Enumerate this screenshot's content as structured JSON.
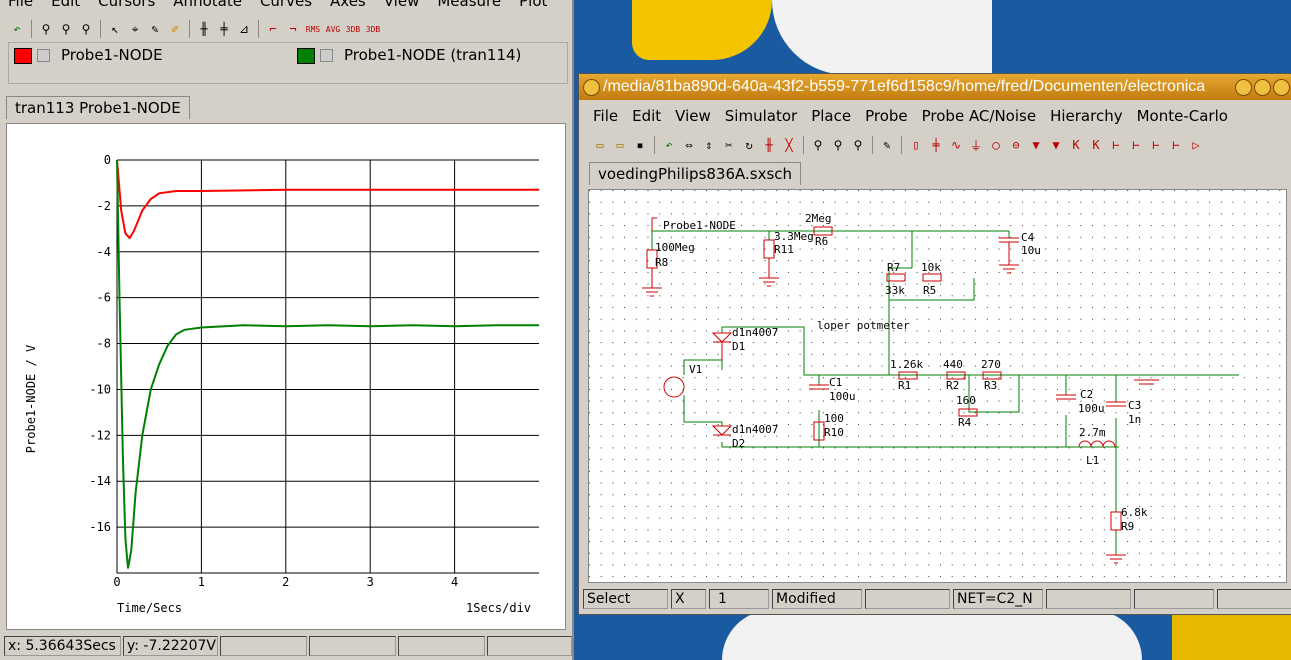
{
  "left_window": {
    "menu": [
      "File",
      "Edit",
      "Cursors",
      "Annotate",
      "Curves",
      "Axes",
      "View",
      "Measure",
      "Plot"
    ],
    "legend": [
      {
        "label": "Probe1-NODE",
        "color": "#ff0000"
      },
      {
        "label": "Probe1-NODE (tran114)",
        "color": "#008000"
      }
    ],
    "tab": "tran113 Probe1-NODE",
    "status": {
      "x": "x: 5.36643Secs",
      "y": "y: -7.22207V"
    }
  },
  "right_window": {
    "title": "/media/81ba890d-640a-43f2-b559-771ef6d158c9/home/fred/Documenten/electronica",
    "menu": [
      "File",
      "Edit",
      "View",
      "Simulator",
      "Place",
      "Probe",
      "Probe AC/Noise",
      "Hierarchy",
      "Monte-Carlo"
    ],
    "tab": "voedingPhilips836A.sxsch",
    "status": {
      "mode": "Select",
      "x_label": "X",
      "x_value": "1",
      "modified": "Modified",
      "net": "NET=C2_N"
    }
  },
  "schematic": {
    "labels": {
      "probe": "Probe1-NODE",
      "r8_val": "100Meg",
      "r8": "R8",
      "r11_val": "3.3Meg",
      "r11": "R11",
      "r6_val": "2Meg",
      "r6": "R6",
      "c4": "C4",
      "c4_val": "10u",
      "r7": "R7",
      "r7_val": "33k",
      "r5_val": "10k",
      "r5": "R5",
      "note": "loper potmeter",
      "d1_val": "d1n4007",
      "d1": "D1",
      "v1": "V1",
      "d2_val": "d1n4007",
      "d2": "D2",
      "c1": "C1",
      "c1_val": "100u",
      "r10_val": "100",
      "r10": "R10",
      "r1_val": "1.26k",
      "r1": "R1",
      "r2_val": "440",
      "r2": "R2",
      "r3_val": "270",
      "r3": "R3",
      "r4_val": "160",
      "r4": "R4",
      "c2": "C2",
      "c2_val": "100u",
      "c3": "C3",
      "c3_val": "1n",
      "l1_val": "2.7m",
      "l1": "L1",
      "r9_val": "6.8k",
      "r9": "R9"
    }
  },
  "chart_data": {
    "type": "line",
    "xlabel": "Time/Secs",
    "ylabel": "Probe1-NODE / V",
    "scale_note": "1Secs/div",
    "xlim": [
      0,
      5
    ],
    "ylim": [
      -18,
      0
    ],
    "x_ticks": [
      "0",
      "1",
      "2",
      "3",
      "4"
    ],
    "y_ticks": [
      "0",
      "-2",
      "-4",
      "-6",
      "-8",
      "-10",
      "-12",
      "-14",
      "-16"
    ],
    "grid": true,
    "series": [
      {
        "name": "Probe1-NODE",
        "color": "#ff0000",
        "x": [
          0,
          0.05,
          0.1,
          0.15,
          0.2,
          0.3,
          0.4,
          0.5,
          0.7,
          1,
          2,
          3,
          4,
          5
        ],
        "y": [
          0,
          -2.2,
          -3.2,
          -3.4,
          -3.1,
          -2.2,
          -1.7,
          -1.45,
          -1.35,
          -1.35,
          -1.3,
          -1.3,
          -1.3,
          -1.3
        ]
      },
      {
        "name": "Probe1-NODE (tran114)",
        "color": "#008000",
        "x": [
          0,
          0.03,
          0.07,
          0.1,
          0.13,
          0.17,
          0.22,
          0.3,
          0.4,
          0.5,
          0.6,
          0.7,
          0.8,
          1,
          1.5,
          2,
          2.5,
          3,
          3.5,
          4,
          4.5,
          5
        ],
        "y": [
          0,
          -6,
          -13,
          -16.5,
          -17.8,
          -17,
          -14.5,
          -12,
          -10,
          -8.9,
          -8.1,
          -7.6,
          -7.4,
          -7.3,
          -7.2,
          -7.25,
          -7.2,
          -7.25,
          -7.2,
          -7.25,
          -7.2,
          -7.2
        ]
      }
    ]
  }
}
